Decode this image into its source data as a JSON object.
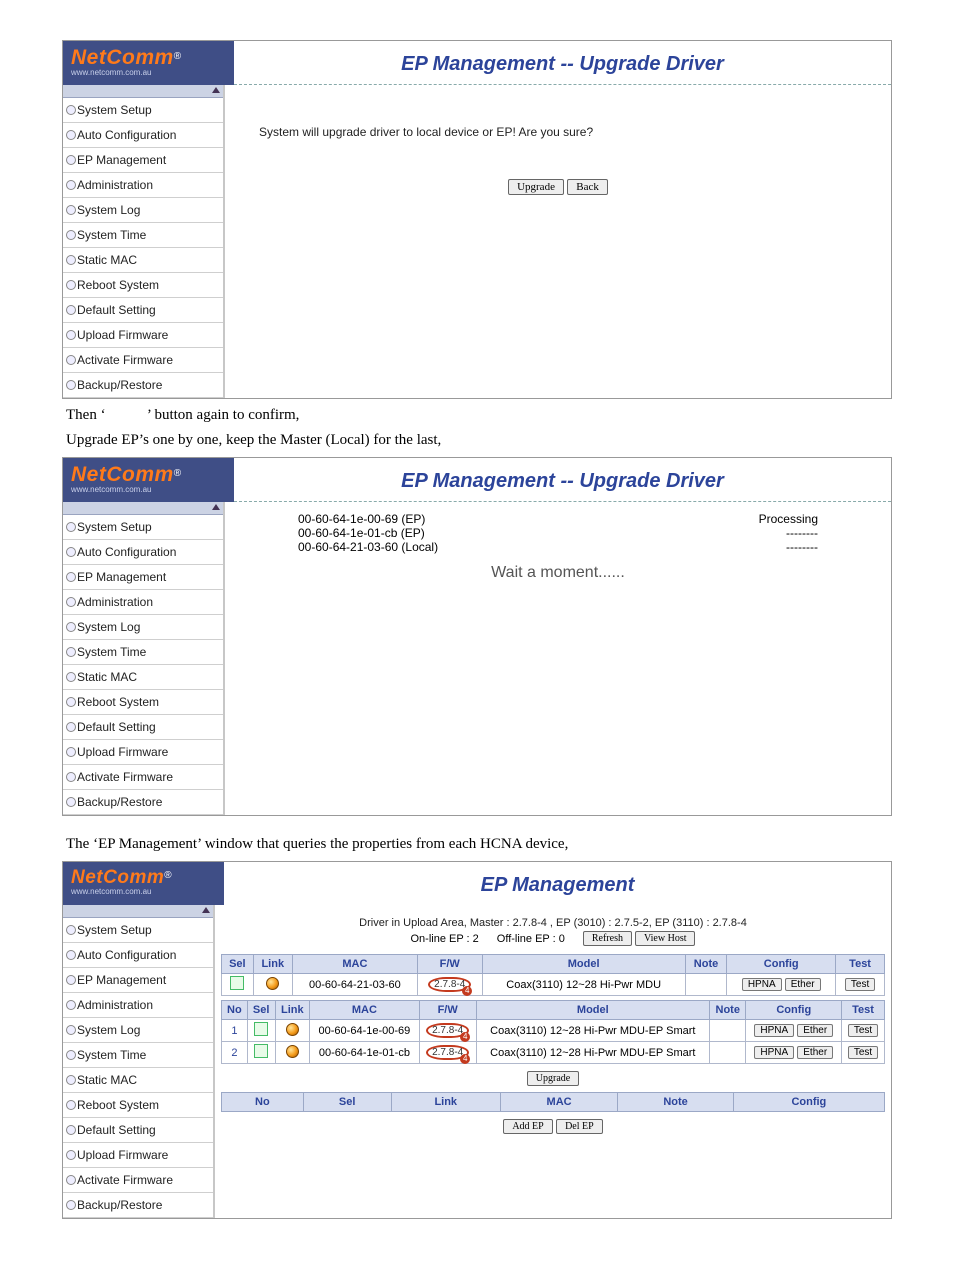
{
  "brand": {
    "name": "NetComm",
    "reg": "®",
    "url": "www.netcomm.com.au"
  },
  "menu": {
    "items": [
      {
        "label": "System Setup"
      },
      {
        "label": "Auto Configuration"
      },
      {
        "label": "EP Management"
      },
      {
        "label": "Administration"
      },
      {
        "label": "System Log"
      },
      {
        "label": "System Time"
      },
      {
        "label": "Static MAC"
      },
      {
        "label": "Reboot System"
      },
      {
        "label": "Default Setting"
      },
      {
        "label": "Upload Firmware"
      },
      {
        "label": "Activate Firmware"
      },
      {
        "label": "Backup/Restore"
      }
    ]
  },
  "shot1": {
    "title": "EP Management -- Upgrade Driver",
    "msg": "System will upgrade driver to local device or EP! Are you sure?",
    "btn_upgrade": "Upgrade",
    "btn_back": "Back"
  },
  "doc": {
    "line1_a": "Then ‘",
    "line1_b": "’ button again to confirm,",
    "line2": "Upgrade EP’s one by one, keep the Master (Local) for the last,",
    "line3": "The ‘EP Management’ window that queries the properties from each HCNA device,"
  },
  "shot2": {
    "title": "EP Management -- Upgrade Driver",
    "rows": [
      {
        "mac": "00-60-64-1e-00-69 (EP)",
        "status": "Processing"
      },
      {
        "mac": "00-60-64-1e-01-cb (EP)",
        "status": "--------"
      },
      {
        "mac": "00-60-64-21-03-60 (Local)",
        "status": "--------"
      }
    ],
    "wait": "Wait a moment......"
  },
  "shot3": {
    "title": "EP Management",
    "driver_line": "Driver in Upload Area, Master : 2.7.8-4 ,   EP (3010) : 2.7.5-2,   EP (3110) : 2.7.8-4",
    "online": "On-line EP : 2",
    "offline": "Off-line EP : 0",
    "btn_refresh": "Refresh",
    "btn_viewhost": "View Host",
    "header1": {
      "sel": "Sel",
      "link": "Link",
      "mac": "MAC",
      "fw": "F/W",
      "model": "Model",
      "note": "Note",
      "config": "Config",
      "test": "Test"
    },
    "local_row": {
      "mac": "00-60-64-21-03-60",
      "fw": "2.7.8-4",
      "model": "Coax(3110) 12~28 Hi-Pwr MDU",
      "btn1": "HPNA",
      "btn2": "Ether",
      "btn3": "Test"
    },
    "header2": {
      "no": "No",
      "sel": "Sel",
      "link": "Link",
      "mac": "MAC",
      "fw": "F/W",
      "model": "Model",
      "note": "Note",
      "config": "Config",
      "test": "Test"
    },
    "eps": [
      {
        "no": "1",
        "mac": "00-60-64-1e-00-69",
        "fw": "2.7.8-4",
        "model": "Coax(3110) 12~28 Hi-Pwr MDU-EP Smart",
        "btn1": "HPNA",
        "btn2": "Ether",
        "btn3": "Test"
      },
      {
        "no": "2",
        "mac": "00-60-64-1e-01-cb",
        "fw": "2.7.8-4",
        "model": "Coax(3110) 12~28 Hi-Pwr MDU-EP Smart",
        "btn1": "HPNA",
        "btn2": "Ether",
        "btn3": "Test"
      }
    ],
    "btn_upgrade": "Upgrade",
    "offheader": {
      "no": "No",
      "sel": "Sel",
      "link": "Link",
      "mac": "MAC",
      "note": "Note",
      "config": "Config"
    },
    "btn_addep": "Add EP",
    "btn_delep": "Del EP"
  }
}
